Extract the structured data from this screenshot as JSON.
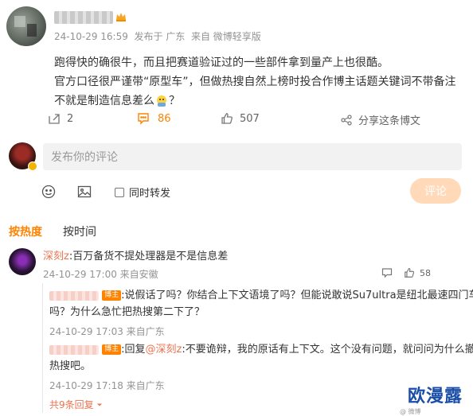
{
  "post": {
    "author_name": "",
    "crown_badge": "crown-icon",
    "meta_time": "24-10-29 16:59",
    "meta_location": "发布于 广东",
    "meta_source": "来自 微博轻享版",
    "body_line1": "跑得快的确很牛，而且把赛道验证过的一些部件拿到量产上也很酷。",
    "body_line2": "官方口径很严谨带“原型车”，但做热搜自然上榜时投合作博主话题关键词不带备注",
    "body_line3": "不就是制造信息差么",
    "body_line3_end": "？",
    "emoji_icon": "thinking-face-emoji",
    "actions": {
      "repost_count": "2",
      "comment_count": "86",
      "like_count": "507",
      "share_label": "分享这条博文"
    }
  },
  "compose": {
    "placeholder": "发布你的评论",
    "sync_repost_label": "同时转发",
    "submit_label": "评论"
  },
  "sort_tabs": {
    "hot": "按热度",
    "time": "按时间"
  },
  "comment": {
    "user": "深刻z",
    "text": ":百万备货不提处理器是不是信息差",
    "meta": "24-10-29 17:00 来自安徽",
    "like_count": "58",
    "replies": [
      {
        "badge": "博主",
        "text_line1": ":说假话了吗？你结合上下文语境了吗？但能说敢说Su7ultra是纽北最速四门车",
        "text_line2": "吗？为什么急忙把热搜第二下了？",
        "meta": "24-10-29 17:03 来自广东"
      },
      {
        "badge": "博主",
        "reply_prefix": ":回复",
        "mention": "@深刻z",
        "text_line1": ":不要诡辩，我的原话有上下文。这个没有问题，就问问为什么撤",
        "text_line2": "热搜吧。",
        "meta": "24-10-29 17:18 来自广东"
      }
    ],
    "more_replies": "共9条回复"
  },
  "watermark": {
    "brand": "欧漫露",
    "small": "@ 微博"
  },
  "colors": {
    "accent_orange": "#ff8200",
    "link_blue": "#eb7350",
    "submit_bg": "#ffd9b8",
    "input_bg": "#f2f2f2"
  }
}
